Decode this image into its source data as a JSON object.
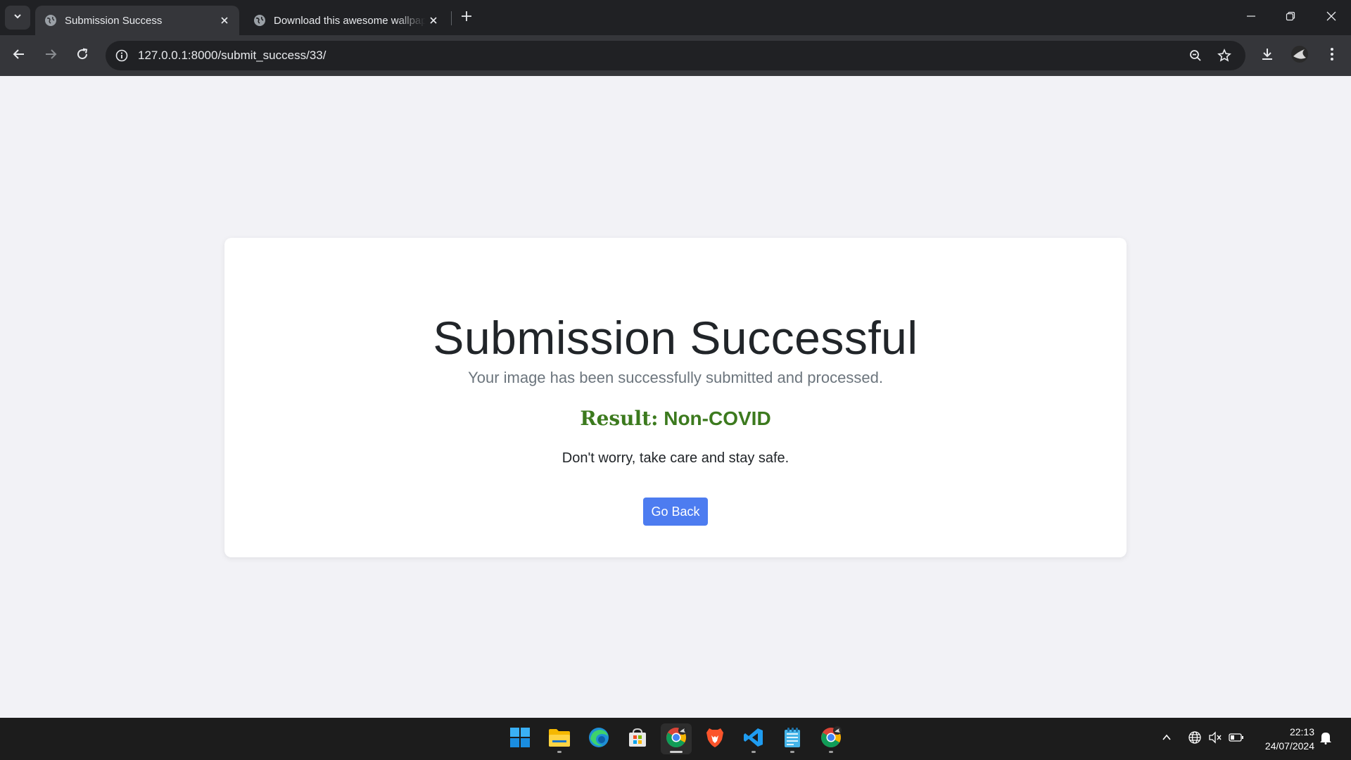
{
  "browser": {
    "tabs": [
      {
        "title": "Submission Success",
        "active": true
      },
      {
        "title": "Download this awesome wallpaper",
        "active": false
      }
    ],
    "url": "127.0.0.1:8000/submit_success/33/"
  },
  "page": {
    "heading": "Submission Successful",
    "subtext": "Your image has been successfully submitted and processed.",
    "result_label": "Result:",
    "result_value": "Non-COVID",
    "advice": "Don't worry, take care and stay safe.",
    "button_label": "Go Back"
  },
  "colors": {
    "result": "#3c7a1e",
    "button": "#4d7cf0",
    "page_bg": "#f2f2f6"
  },
  "taskbar": {
    "apps": [
      "start",
      "file-explorer",
      "edge",
      "microsoft-store",
      "chrome",
      "brave",
      "vscode",
      "notepad",
      "chrome-profile"
    ],
    "time": "22:13",
    "date": "24/07/2024"
  }
}
